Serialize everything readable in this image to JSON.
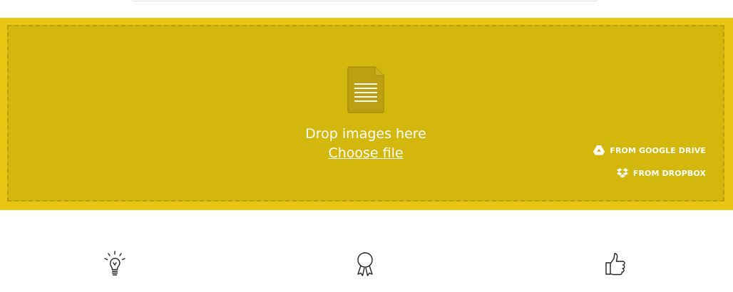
{
  "dropzone": {
    "title": "Drop images here",
    "choose_file_label": "Choose file",
    "icon": "document-icon"
  },
  "cloud_sources": {
    "google_drive_label": "FROM GOOGLE DRIVE",
    "dropbox_label": "FROM DROPBOX"
  },
  "features": [
    {
      "icon": "lightbulb-icon"
    },
    {
      "icon": "award-ribbon-icon"
    },
    {
      "icon": "thumbs-up-icon"
    }
  ],
  "colors": {
    "outer_border": "#e8c613",
    "drop_background": "#d4b70d",
    "dashed_border": "#b89f0a",
    "doc_icon": "#bf9f12",
    "text": "#ffffff"
  }
}
